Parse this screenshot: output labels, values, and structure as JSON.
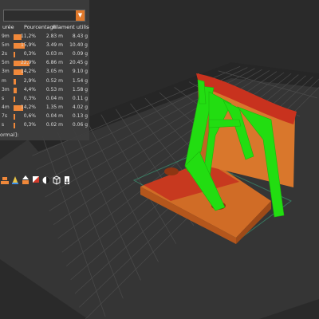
{
  "legend": {
    "columns": {
      "time": "urée",
      "percent": "Pourcentage",
      "filament": "Filament utilisé"
    },
    "rows": [
      {
        "time": "9m",
        "percent": "11,2%",
        "meters": "2.83 m",
        "grams": "8.43 g",
        "fraction": 0.112
      },
      {
        "time": "5m",
        "percent": "15,9%",
        "meters": "3.49 m",
        "grams": "10.40 g",
        "fraction": 0.159
      },
      {
        "time": "2s",
        "percent": "0,3%",
        "meters": "0.03 m",
        "grams": "0.09 g",
        "fraction": 0.003
      },
      {
        "time": "5m",
        "percent": "22,9%",
        "meters": "6.86 m",
        "grams": "20.45 g",
        "fraction": 0.229
      },
      {
        "time": "3m",
        "percent": "14,2%",
        "meters": "3.05 m",
        "grams": "9.10 g",
        "fraction": 0.142
      },
      {
        "time": "m",
        "percent": "2,9%",
        "meters": "0.52 m",
        "grams": "1.54 g",
        "fraction": 0.029
      },
      {
        "time": "3m",
        "percent": "4,4%",
        "meters": "0.53 m",
        "grams": "1.58 g",
        "fraction": 0.044
      },
      {
        "time": "s",
        "percent": "0,3%",
        "meters": "0.04 m",
        "grams": "0.11 g",
        "fraction": 0.003
      },
      {
        "time": "4m",
        "percent": "14,2%",
        "meters": "1.35 m",
        "grams": "4.02 g",
        "fraction": 0.142
      },
      {
        "time": "7s",
        "percent": "0,6%",
        "meters": "0.04 m",
        "grams": "0.13 g",
        "fraction": 0.006
      },
      {
        "time": "s",
        "percent": "0,3%",
        "meters": "0.02 m",
        "grams": "0.06 g",
        "fraction": 0.003
      }
    ],
    "footer": "ormal]:"
  },
  "toolbar": {
    "icons": [
      "layers-icon",
      "support-icon",
      "seam-icon",
      "infill-icon",
      "paint-icon",
      "cube-icon",
      "export-icon"
    ]
  },
  "colors": {
    "accent": "#f0883a",
    "model": "#d9772c",
    "top_surface": "#c8321e",
    "support": "#22dd11",
    "bed": "#2f2f2f",
    "grid": "#4a4a4a"
  }
}
